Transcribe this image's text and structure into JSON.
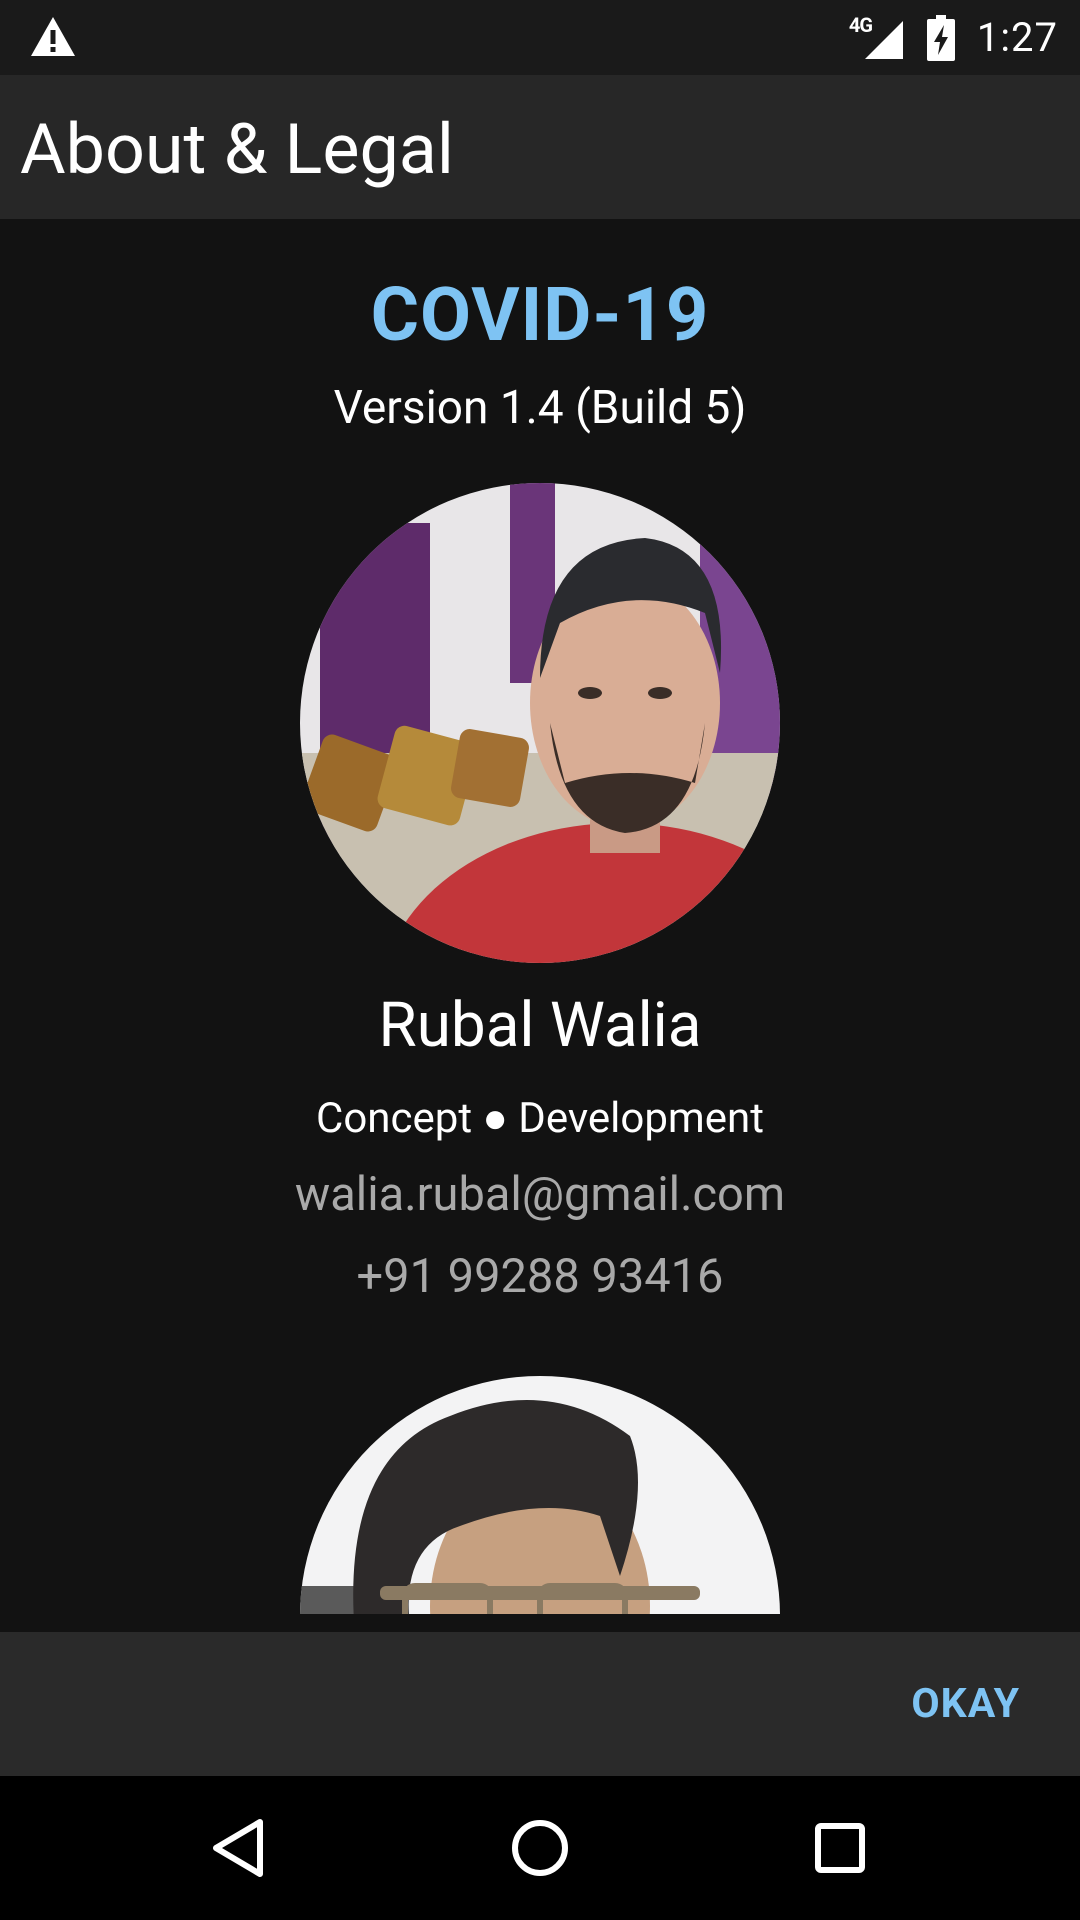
{
  "status_bar": {
    "network": "4G",
    "time": "1:27",
    "icons": [
      "warning-icon",
      "signal-icon",
      "battery-charging-icon"
    ]
  },
  "app_bar": {
    "title": "About & Legal"
  },
  "about": {
    "app_name": "COVID-19",
    "version": "Version 1.4 (Build 5)"
  },
  "contributors": [
    {
      "name": "Rubal Walia",
      "role": "Concept ● Development",
      "email": "walia.rubal@gmail.com",
      "phone": "+91 99288 93416"
    }
  ],
  "dialog": {
    "okay_label": "OKAY"
  },
  "colors": {
    "accent": "#7ec3f3",
    "background": "#121212",
    "app_bar": "#272727",
    "footer": "#2a2a2a",
    "secondary_text": "#a9a9a9"
  },
  "nav_bar": {
    "icons": [
      "back-icon",
      "home-icon",
      "recents-icon"
    ]
  }
}
